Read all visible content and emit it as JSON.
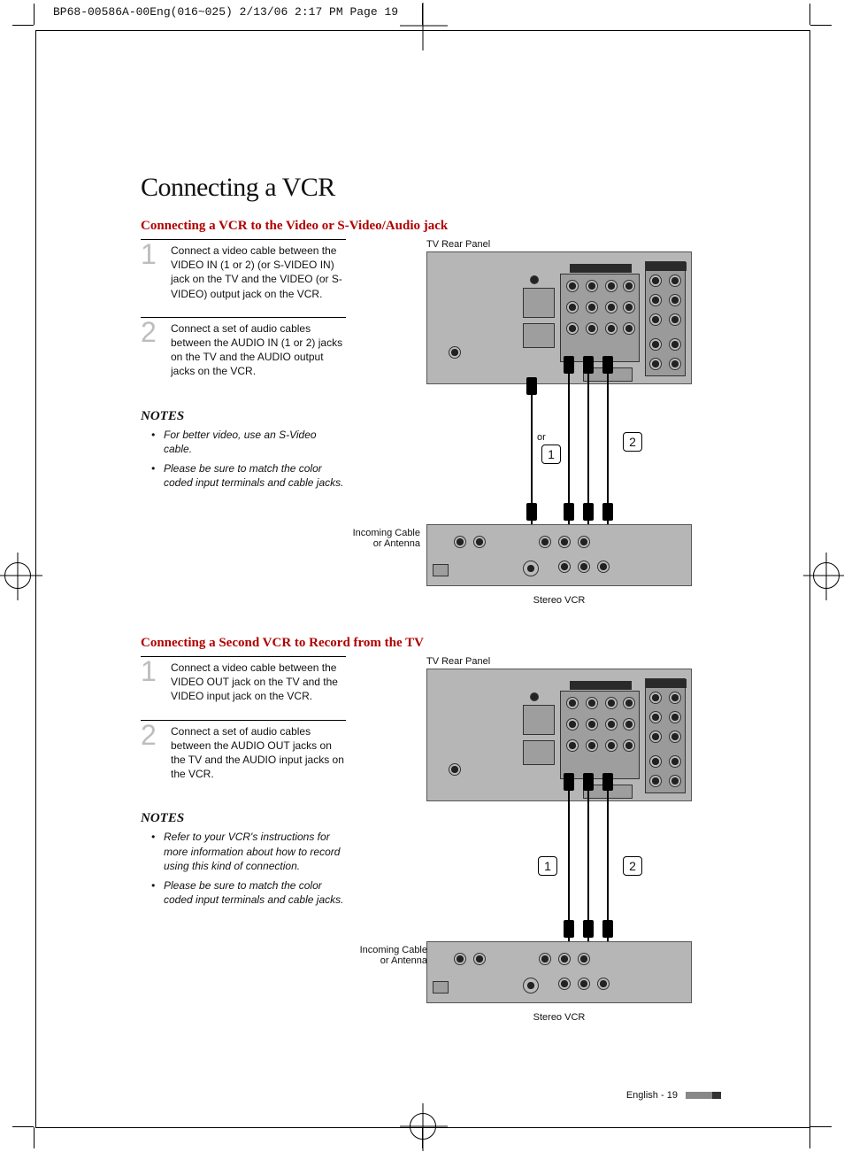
{
  "print_header": "BP68-00586A-00Eng(016~025)  2/13/06  2:17 PM  Page 19",
  "title": "Connecting a VCR",
  "section1": {
    "heading": "Connecting a VCR to the Video or S-Video/Audio jack",
    "step1_num": "1",
    "step1_text": "Connect a video cable between the VIDEO IN (1 or 2) (or S-VIDEO IN) jack on the TV and the VIDEO (or S-VIDEO) output jack on the VCR.",
    "step2_num": "2",
    "step2_text": "Connect a set of audio cables between the AUDIO IN (1 or 2) jacks on the TV and the AUDIO output jacks on the VCR.",
    "notes_head": "NOTES",
    "note1": "For better video, use an S-Video cable.",
    "note2": "Please be sure to match the color coded input terminals and cable jacks.",
    "caption_top": "TV Rear Panel",
    "incoming": "Incoming Cable or Antenna",
    "or": "or",
    "callout1": "1",
    "callout2": "2",
    "caption_bottom": "Stereo VCR"
  },
  "section2": {
    "heading": "Connecting a Second VCR to Record from the TV",
    "step1_num": "1",
    "step1_text": "Connect a video cable between the VIDEO OUT jack on the TV and the VIDEO input jack on the VCR.",
    "step2_num": "2",
    "step2_text": "Connect a set of audio cables between the AUDIO OUT jacks on the TV and the AUDIO input jacks on the VCR.",
    "notes_head": "NOTES",
    "note1": "Refer to your VCR's instructions for more information about how to record using this kind of connection.",
    "note2": "Please be sure to match the color coded input terminals and cable jacks.",
    "caption_top": "TV Rear Panel",
    "incoming": "Incoming Cable or Antenna",
    "callout1": "1",
    "callout2": "2",
    "caption_bottom": "Stereo VCR"
  },
  "footer": "English - 19"
}
